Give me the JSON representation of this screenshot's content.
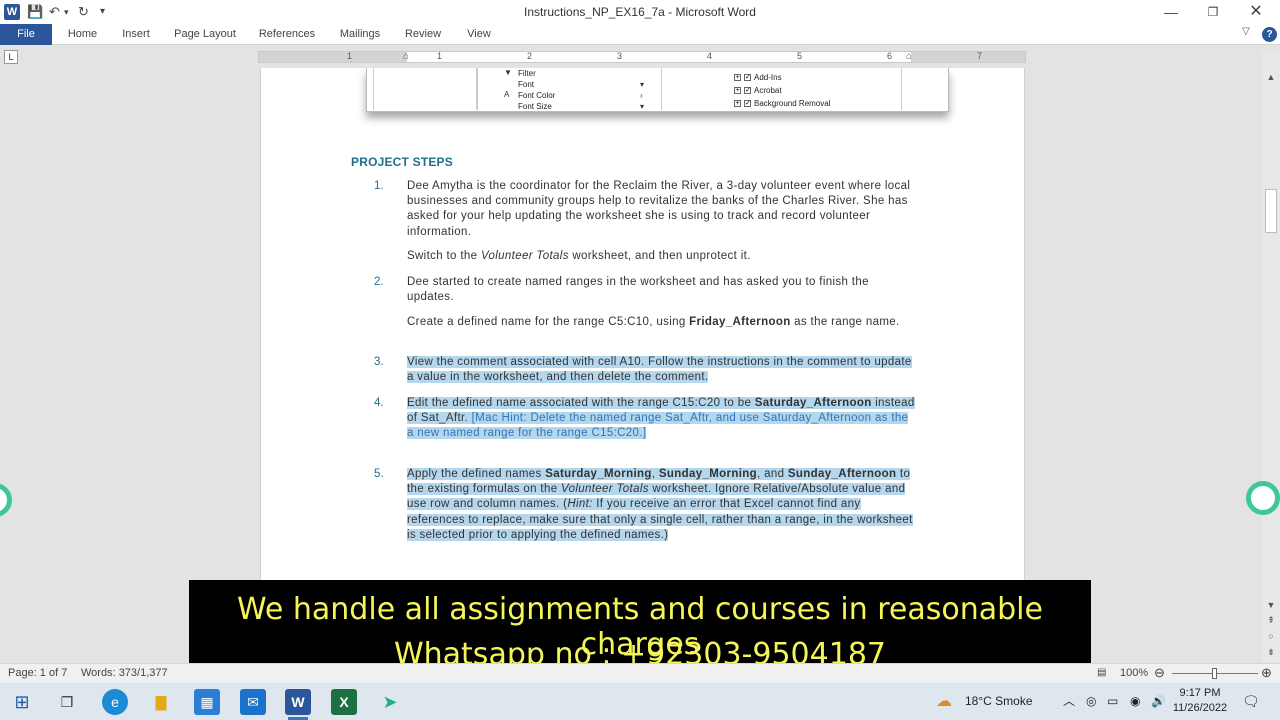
{
  "window": {
    "title": "Instructions_NP_EX16_7a",
    "app_name": "Microsoft Word",
    "separator": "-",
    "app_icon": "W"
  },
  "quick_access": {
    "save_icon": "save-icon",
    "undo_icon": "undo-icon",
    "redo_icon": "redo-icon",
    "customize_icon": "customize-qat-icon"
  },
  "ribbon": {
    "tabs": [
      "File",
      "Home",
      "Insert",
      "Page Layout",
      "References",
      "Mailings",
      "Review",
      "View"
    ]
  },
  "ruler": {
    "numbers": [
      "1",
      "1",
      "2",
      "3",
      "4",
      "5",
      "6",
      "7"
    ]
  },
  "embedded_image": {
    "left_items": [
      "Filter",
      "Font",
      "Font Color",
      "Font Size"
    ],
    "right_items": [
      "Add-Ins",
      "Acrobat",
      "Background Removal"
    ]
  },
  "document": {
    "heading": "PROJECT STEPS",
    "steps": [
      {
        "number": "1.",
        "p1": "Dee Amytha is the coordinator for the Reclaim the River, a 3-day volunteer event where local businesses and community groups help to revitalize the banks of the Charles River. She has asked for your help updating the worksheet she is using to track and record volunteer information.",
        "p2_before": "Switch to the ",
        "p2_italic": "Volunteer Totals",
        "p2_after": " worksheet, and then unprotect it."
      },
      {
        "number": "2.",
        "p1": "Dee started to create named ranges in the worksheet and has asked you to finish the updates.",
        "p2_before": "Create a defined name for the range C5:C10, using ",
        "p2_bold": "Friday_Afternoon",
        "p2_after": " as the range name."
      },
      {
        "number": "3.",
        "p1": "View the comment associated with cell A10. Follow the instructions in the comment to update a value in the worksheet, and then delete the comment."
      },
      {
        "number": "4.",
        "p1_before": "Edit the defined name associated with the range C15:C20 to be ",
        "p1_bold": "Saturday_Afternoon",
        "p1_mid": " instead of Sat_Aftr. ",
        "p1_hint": "[Mac Hint: Delete the named range Sat_Aftr, and use Saturday_Afternoon as the a new named range for the range C15:C20.]"
      },
      {
        "number": "5.",
        "p1_a": "Apply the defined names ",
        "p1_b1": "Saturday_Morning",
        "p1_c": ", ",
        "p1_b2": "Sunday_Morning",
        "p1_d": ", and ",
        "p1_b3": "Sunday_Afternoon",
        "p1_e": " to the existing formulas on the ",
        "p1_i1": "Volunteer Totals",
        "p1_f": " worksheet. Ignore Relative/Absolute value and use row and column names. (",
        "p1_i2": "Hint:",
        "p1_g": " If you receive an error that Excel cannot find any references to replace, make sure that only a single cell, rather than a range, in the worksheet is selected prior to applying the defined names.)"
      }
    ]
  },
  "caption": {
    "line1": "We handle all assignments and courses in reasonable charges",
    "line2": "Whatsapp no : +92303-9504187"
  },
  "status": {
    "page": "Page: 1 of 7",
    "words": "Words: 373/1,377",
    "zoom": "100%",
    "zoom_level": 0.5
  },
  "taskbar": {
    "weather": "18°C  Smoke",
    "time": "9:17 PM",
    "date": "11/26/2022",
    "apps": [
      "start-icon",
      "task-view-icon",
      "edge-icon",
      "file-explorer-icon",
      "store-icon",
      "mail-icon",
      "word-icon",
      "excel-icon",
      "app-icon"
    ]
  },
  "colors": {
    "word_blue": "#2b579a",
    "heading_teal": "#1f6f8b",
    "selection": "#b5d7ee",
    "caption_text": "#f5f55a"
  }
}
